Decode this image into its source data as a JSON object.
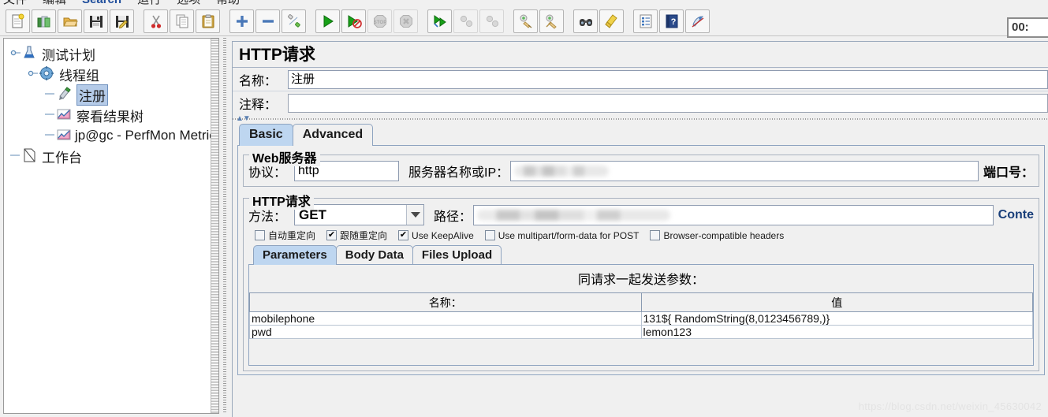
{
  "menu": {
    "items": [
      {
        "label": "文件",
        "accent": false
      },
      {
        "label": "编辑",
        "accent": false
      },
      {
        "label": "Search",
        "accent": true
      },
      {
        "label": "运行",
        "accent": false
      },
      {
        "label": "选项",
        "accent": false
      },
      {
        "label": "帮助",
        "accent": false
      }
    ]
  },
  "toolbar": {
    "buttons": [
      {
        "name": "new-icon",
        "tip": "新建"
      },
      {
        "name": "templates-icon",
        "tip": "模板"
      },
      {
        "name": "open-icon",
        "tip": "打开"
      },
      {
        "name": "save-icon",
        "tip": "保存"
      },
      {
        "name": "save-as-icon",
        "tip": "另存为"
      },
      {
        "name": "cut-icon",
        "tip": "剪切"
      },
      {
        "name": "copy-icon",
        "tip": "复制"
      },
      {
        "name": "paste-icon",
        "tip": "粘贴"
      },
      {
        "name": "expand-icon",
        "tip": "展开"
      },
      {
        "name": "collapse-icon",
        "tip": "折叠"
      },
      {
        "name": "toggle-icon",
        "tip": "启用/禁用"
      },
      {
        "name": "start-icon",
        "tip": "启动"
      },
      {
        "name": "start-no-pause-icon",
        "tip": "无间隔启动"
      },
      {
        "name": "stop-icon",
        "tip": "停止"
      },
      {
        "name": "shutdown-icon",
        "tip": "关闭"
      },
      {
        "name": "remote-start-all-icon",
        "tip": "远程全部启动"
      },
      {
        "name": "remote-stop-all-icon",
        "tip": "远程全部停止"
      },
      {
        "name": "remote-shutdown-all-icon",
        "tip": "远程全部关闭"
      },
      {
        "name": "clear-icon",
        "tip": "清除"
      },
      {
        "name": "clear-all-icon",
        "tip": "清除全部"
      },
      {
        "name": "search-icon",
        "tip": "查找"
      },
      {
        "name": "reset-search-icon",
        "tip": "重置查找"
      },
      {
        "name": "function-helper-icon",
        "tip": "函数助手"
      },
      {
        "name": "help-icon",
        "tip": "帮助"
      },
      {
        "name": "about-icon",
        "tip": "关于"
      }
    ],
    "timer": "00:"
  },
  "tree": {
    "nodes": [
      {
        "label": "测试计划",
        "icon": "test-plan-icon",
        "depth": 0,
        "selected": false,
        "handle": true
      },
      {
        "label": "线程组",
        "icon": "thread-group-icon",
        "depth": 1,
        "selected": false,
        "handle": true
      },
      {
        "label": "注册",
        "icon": "http-sampler-icon",
        "depth": 2,
        "selected": true,
        "handle": false
      },
      {
        "label": "察看结果树",
        "icon": "view-results-tree-icon",
        "depth": 2,
        "selected": false,
        "handle": false
      },
      {
        "label": "jp@gc - PerfMon Metrics",
        "icon": "perfmon-icon",
        "depth": 2,
        "selected": false,
        "handle": false
      },
      {
        "label": "工作台",
        "icon": "workbench-icon",
        "depth": 0,
        "selected": false,
        "handle": false
      }
    ]
  },
  "panel": {
    "title": "HTTP请求",
    "name_label": "名称：",
    "name_value": "注册",
    "comment_label": "注释：",
    "comment_value": "",
    "tabs": [
      {
        "label": "Basic",
        "active": true
      },
      {
        "label": "Advanced",
        "active": false
      }
    ],
    "webserver": {
      "group_title": "Web服务器",
      "protocol_label": "协议：",
      "protocol_value": "http",
      "server_label": "服务器名称或IP：",
      "server_value": "",
      "server_redacted": true,
      "port_label": "端口号：",
      "port_value": ""
    },
    "httprequest": {
      "group_title": "HTTP请求",
      "method_label": "方法：",
      "method_value": "GET",
      "path_label": "路径：",
      "path_value": "",
      "path_redacted": true,
      "content_label": "Conte",
      "checkboxes": [
        {
          "label": "自动重定向",
          "checked": false
        },
        {
          "label": "跟随重定向",
          "checked": true
        },
        {
          "label": "Use KeepAlive",
          "checked": true
        },
        {
          "label": "Use multipart/form-data for POST",
          "checked": false
        },
        {
          "label": "Browser-compatible headers",
          "checked": false
        }
      ]
    },
    "inner_tabs": [
      {
        "label": "Parameters",
        "active": true
      },
      {
        "label": "Body Data",
        "active": false
      },
      {
        "label": "Files Upload",
        "active": false
      }
    ],
    "params_table": {
      "caption": "同请求一起发送参数：",
      "headers": [
        "名称：",
        "值"
      ],
      "rows": [
        [
          "mobilephone",
          "131${   RandomString(8,0123456789,)}"
        ],
        [
          "pwd",
          "lemon123"
        ]
      ]
    }
  },
  "watermark": "https://blog.csdn.net/weixin_45630042",
  "colors": {
    "selection": "#b5cbe8",
    "tab_active": "#bed6f0",
    "panel_bg": "#f0f0f0",
    "border": "#8fa4c0",
    "accent_menu": "#1f4e9c"
  }
}
